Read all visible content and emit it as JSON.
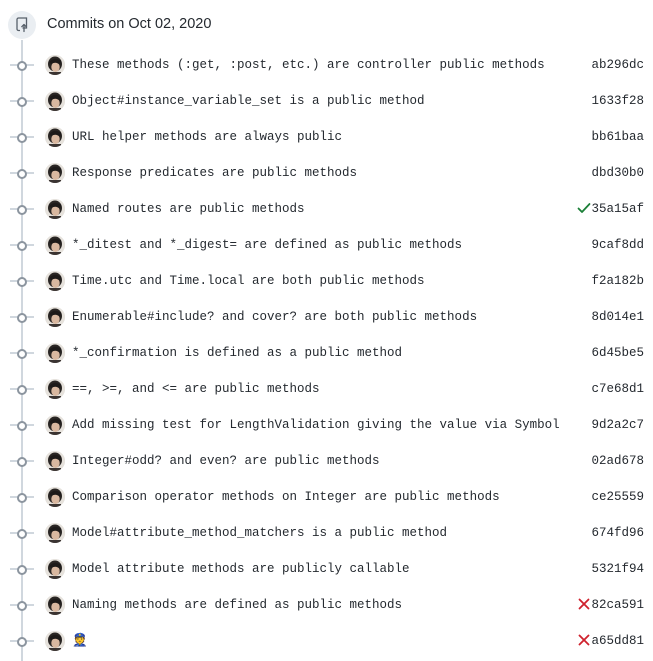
{
  "header": {
    "title": "Commits on Oct 02, 2020",
    "icon": "repo-push-icon"
  },
  "colors": {
    "timeline": "#d0d7de",
    "success": "#1a7f37",
    "failure": "#cf222e"
  },
  "commits": [
    {
      "message": "These methods (:get, :post, etc.) are controller public methods",
      "sha": "ab296dc",
      "status": "none"
    },
    {
      "message": "Object#instance_variable_set is a public method",
      "sha": "1633f28",
      "status": "none"
    },
    {
      "message": "URL helper methods are always public",
      "sha": "bb61baa",
      "status": "none"
    },
    {
      "message": "Response predicates are public methods",
      "sha": "dbd30b0",
      "status": "none"
    },
    {
      "message": "Named routes are public methods",
      "sha": "35a15af",
      "status": "success"
    },
    {
      "message": "*_ditest and *_digest= are defined as public methods",
      "sha": "9caf8dd",
      "status": "none"
    },
    {
      "message": "Time.utc and Time.local are both public methods",
      "sha": "f2a182b",
      "status": "none"
    },
    {
      "message": "Enumerable#include? and cover? are both public methods",
      "sha": "8d014e1",
      "status": "none"
    },
    {
      "message": "*_confirmation is defined as a public method",
      "sha": "6d45be5",
      "status": "none"
    },
    {
      "message": "==, >=, and <= are public methods",
      "sha": "c7e68d1",
      "status": "none"
    },
    {
      "message": "Add missing test for LengthValidation giving the value via Symbol",
      "sha": "9d2a2c7",
      "status": "none"
    },
    {
      "message": "Integer#odd? and even? are public methods",
      "sha": "02ad678",
      "status": "none"
    },
    {
      "message": "Comparison operator methods on Integer are public methods",
      "sha": "ce25559",
      "status": "none"
    },
    {
      "message": "Model#attribute_method_matchers is a public method",
      "sha": "674fd96",
      "status": "none"
    },
    {
      "message": "Model attribute methods are publicly callable",
      "sha": "5321f94",
      "status": "none"
    },
    {
      "message": "Naming methods are defined as public methods",
      "sha": "82ca591",
      "status": "failure"
    },
    {
      "message": "👮",
      "sha": "a65dd81",
      "status": "failure"
    }
  ]
}
